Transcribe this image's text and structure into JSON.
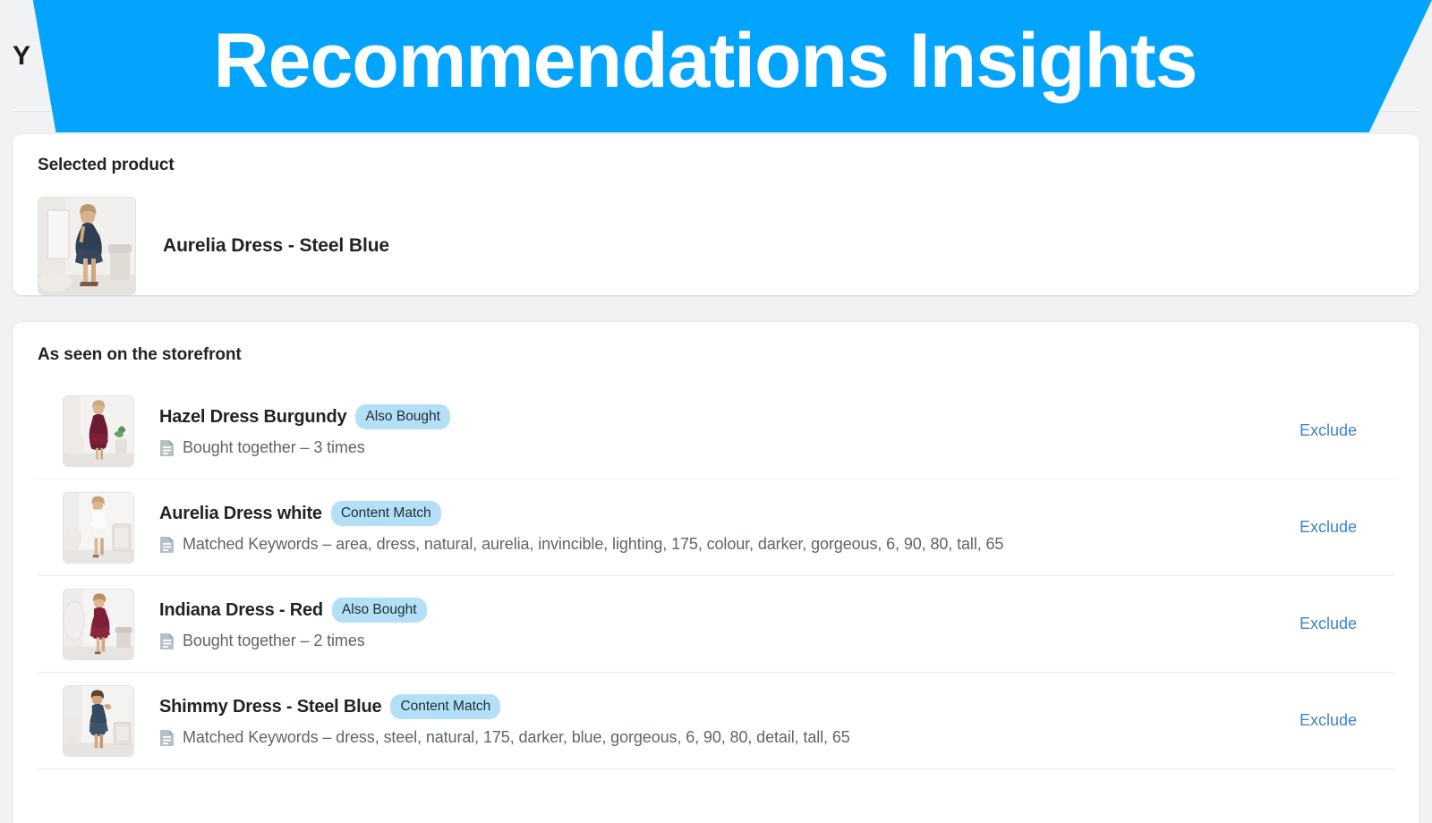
{
  "page": {
    "title_visible_fragment": "Y",
    "background_color": "#f1f2f4"
  },
  "banner": {
    "title": "Recommendations Insights",
    "background_color": "#03a4fd",
    "text_color": "#ffffff"
  },
  "selected_product": {
    "heading": "Selected product",
    "name": "Aurelia Dress - Steel Blue",
    "thumbnail": "product-photo-navy-dress"
  },
  "storefront": {
    "heading": "As seen on the storefront",
    "exclude_label": "Exclude",
    "badge_colors": {
      "background": "#b4e0f7",
      "text": "#1f2d33"
    },
    "link_color": "#3f80d0",
    "items": [
      {
        "name": "Hazel Dress Burgundy",
        "badge": "Also Bought",
        "meta_icon": "document-icon",
        "meta": "Bought together – 3 times",
        "exclude": "Exclude",
        "thumbnail": "product-photo-burgundy-dress"
      },
      {
        "name": "Aurelia Dress white",
        "badge": "Content Match",
        "meta_icon": "document-icon",
        "meta": "Matched Keywords – area, dress, natural, aurelia, invincible, lighting, 175, colour, darker, gorgeous, 6, 90, 80, tall, 65",
        "exclude": "Exclude",
        "thumbnail": "product-photo-white-dress"
      },
      {
        "name": "Indiana Dress - Red",
        "badge": "Also Bought",
        "meta_icon": "document-icon",
        "meta": "Bought together – 2 times",
        "exclude": "Exclude",
        "thumbnail": "product-photo-red-dress"
      },
      {
        "name": "Shimmy Dress - Steel Blue",
        "badge": "Content Match",
        "meta_icon": "document-icon",
        "meta": "Matched Keywords – dress, steel, natural, 175, darker, blue, gorgeous, 6, 90, 80, detail, tall, 65",
        "exclude": "Exclude",
        "thumbnail": "product-photo-steel-blue-dress"
      }
    ]
  }
}
